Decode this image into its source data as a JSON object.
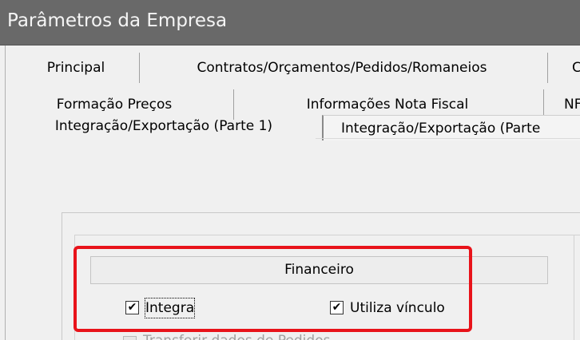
{
  "window": {
    "title": "Parâmetros da Empresa"
  },
  "tabs": {
    "row1": [
      "Principal",
      "Contratos/Orçamentos/Pedidos/Romaneios",
      "C"
    ],
    "row2": [
      "Formação Preços",
      "Informações Nota Fiscal",
      "NF"
    ],
    "row3": [
      "Integração/Exportação (Parte 1)",
      "Integração/Exportação (Parte"
    ],
    "selected": "Integração/Exportação (Parte"
  },
  "group": {
    "header": "Financeiro",
    "checkboxes": [
      {
        "label": "Integra",
        "checked": true,
        "focused": true
      },
      {
        "label": "Utiliza vínculo",
        "checked": true,
        "focused": false
      }
    ],
    "partial_row_label": "Transferir dados de Pedidos"
  },
  "colors": {
    "titlebar": "#696969",
    "highlight": "#e8131a",
    "background": "#f0f0f0"
  },
  "icons": {
    "check": "✔"
  }
}
